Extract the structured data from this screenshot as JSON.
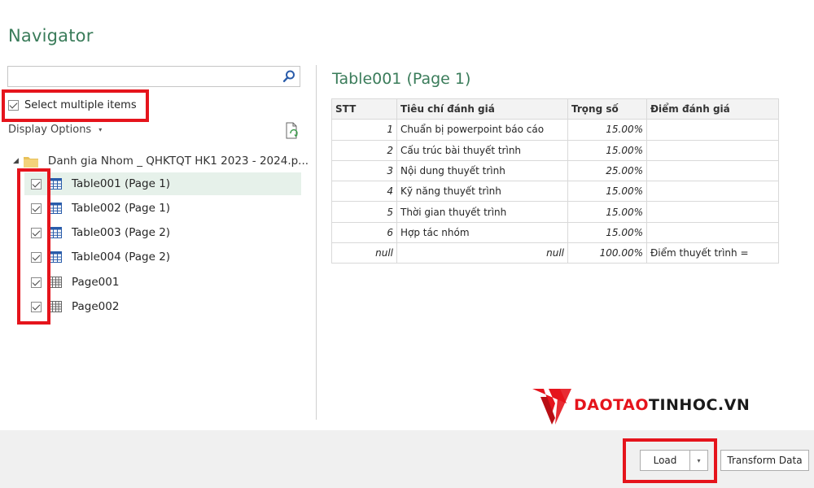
{
  "window": {
    "title": "Navigator"
  },
  "left_panel": {
    "search": {
      "value": "",
      "placeholder": "",
      "icon": "search-icon"
    },
    "select_multiple": {
      "label": "Select multiple items",
      "checked": true
    },
    "display_options": {
      "label": "Display Options",
      "caret": "▾"
    },
    "tree": {
      "root": {
        "label": "Danh gia Nhom _ QHKTQT HK1 2023 - 2024.p...",
        "icon": "folder-icon",
        "expanded": true
      },
      "items": [
        {
          "label": "Table001 (Page 1)",
          "checked": true,
          "icon": "table-icon",
          "selected": true
        },
        {
          "label": "Table002 (Page 1)",
          "checked": true,
          "icon": "table-icon",
          "selected": false
        },
        {
          "label": "Table003 (Page 2)",
          "checked": true,
          "icon": "table-icon",
          "selected": false
        },
        {
          "label": "Table004 (Page 2)",
          "checked": true,
          "icon": "table-icon",
          "selected": false
        },
        {
          "label": "Page001",
          "checked": true,
          "icon": "page-icon",
          "selected": false
        },
        {
          "label": "Page002",
          "checked": true,
          "icon": "page-icon",
          "selected": false
        }
      ]
    }
  },
  "preview": {
    "title": "Table001 (Page 1)",
    "columns": [
      "STT",
      "Tiêu chí đánh giá",
      "Trọng số",
      "Điểm đánh giá"
    ],
    "rows": [
      [
        "1",
        "Chuẩn bị powerpoint báo cáo",
        "15.00%",
        ""
      ],
      [
        "2",
        "Cấu trúc bài thuyết trình",
        "15.00%",
        ""
      ],
      [
        "3",
        "Nội dung thuyết trình",
        "25.00%",
        ""
      ],
      [
        "4",
        "Kỹ năng thuyết trình",
        "15.00%",
        ""
      ],
      [
        "5",
        "Thời gian thuyết trình",
        "15.00%",
        ""
      ],
      [
        "6",
        "Hợp tác nhóm",
        "15.00%",
        ""
      ],
      [
        "null",
        "null",
        "100.00%",
        "Điểm thuyết trình ="
      ]
    ]
  },
  "watermark": {
    "text_red": "DAOTAO",
    "text_black": "TINHOC.VN"
  },
  "footer": {
    "load_label": "Load",
    "load_dropdown_caret": "▾",
    "transform_label": "Transform Data"
  },
  "colors": {
    "accent_green": "#3a7c5a",
    "highlight_red": "#e5141c",
    "selected_row": "#e6f1ea"
  }
}
